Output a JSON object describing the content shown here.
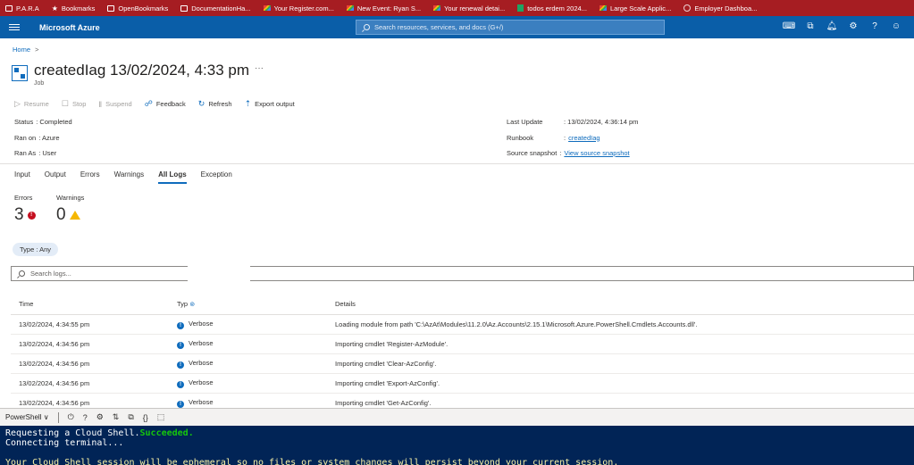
{
  "bookmarks": [
    {
      "label": "P.A.R.A",
      "icon": "folder-icon"
    },
    {
      "label": "Bookmarks",
      "icon": "star-icon"
    },
    {
      "label": "OpenBookmarks",
      "icon": "folder-icon"
    },
    {
      "label": "DocumentationHa...",
      "icon": "folder-icon"
    },
    {
      "label": "Your Register.com...",
      "icon": "gmail-icon"
    },
    {
      "label": "New Event: Ryan S...",
      "icon": "gmail-icon"
    },
    {
      "label": "Your renewal detai...",
      "icon": "gmail-icon"
    },
    {
      "label": "todos erdem 2024...",
      "icon": "sheets-icon"
    },
    {
      "label": "Large Scale Applic...",
      "icon": "gmail-icon"
    },
    {
      "label": "Employer Dashboa...",
      "icon": "globe-icon"
    }
  ],
  "topbar": {
    "brand": "Microsoft Azure",
    "search_placeholder": "Search resources, services, and docs (G+/)"
  },
  "breadcrumb": {
    "home": "Home",
    "sep": ">"
  },
  "header": {
    "title": "createdIag 13/02/2024, 4:33 pm",
    "more": "···",
    "subtitle": "Job"
  },
  "toolbar": {
    "resume": "Resume",
    "stop": "Stop",
    "suspend": "Suspend",
    "feedback": "Feedback",
    "refresh": "Refresh",
    "export": "Export output"
  },
  "props_left": [
    {
      "label": "Status",
      "value": ": Completed"
    },
    {
      "label": "Ran on",
      "value": ": Azure"
    },
    {
      "label": "Ran As",
      "value": ": User"
    }
  ],
  "props_right": {
    "last_update_label": "Last Update",
    "last_update_value": ": 13/02/2024, 4:36:14 pm",
    "runbook_label": "Runbook",
    "runbook_value": "createdIag",
    "snapshot_label": "Source snapshot",
    "snapshot_value": "View source snapshot"
  },
  "tabs": [
    "Input",
    "Output",
    "Errors",
    "Warnings",
    "All Logs",
    "Exception"
  ],
  "active_tab": "All Logs",
  "counts": {
    "errors_label": "Errors",
    "errors_value": "3",
    "warnings_label": "Warnings",
    "warnings_value": "0"
  },
  "filter": {
    "type_pill": "Type : Any"
  },
  "log_search": {
    "placeholder": "Search logs..."
  },
  "table": {
    "headers": {
      "time": "Time",
      "type": "Typ",
      "details": "Details"
    },
    "rows": [
      {
        "time": "13/02/2024, 4:34:55 pm",
        "type": "Verbose",
        "details": "Loading module from path 'C:\\AzAt\\Modules\\11.2.0\\Az.Accounts\\2.15.1\\Microsoft.Azure.PowerShell.Cmdlets.Accounts.dll'."
      },
      {
        "time": "13/02/2024, 4:34:56 pm",
        "type": "Verbose",
        "details": "Importing cmdlet 'Register-AzModule'."
      },
      {
        "time": "13/02/2024, 4:34:56 pm",
        "type": "Verbose",
        "details": "Importing cmdlet 'Clear-AzConfig'."
      },
      {
        "time": "13/02/2024, 4:34:56 pm",
        "type": "Verbose",
        "details": "Importing cmdlet 'Export-AzConfig'."
      },
      {
        "time": "13/02/2024, 4:34:56 pm",
        "type": "Verbose",
        "details": "Importing cmdlet 'Get-AzConfig'."
      }
    ]
  },
  "shell": {
    "mode": "PowerShell",
    "line1_prefix": "Requesting a Cloud Shell.",
    "line1_status": "Succeeded.",
    "line2": "Connecting terminal...",
    "line3": "Your Cloud Shell session will be ephemeral so no files or system changes will persist beyond your current session."
  },
  "colors": {
    "bookmarks_bar": "#a61d22",
    "azure_blue": "#0a5ea8",
    "link": "#0f6cbd",
    "error": "#c50f1f",
    "warning": "#f5b700",
    "terminal_bg": "#012456"
  }
}
